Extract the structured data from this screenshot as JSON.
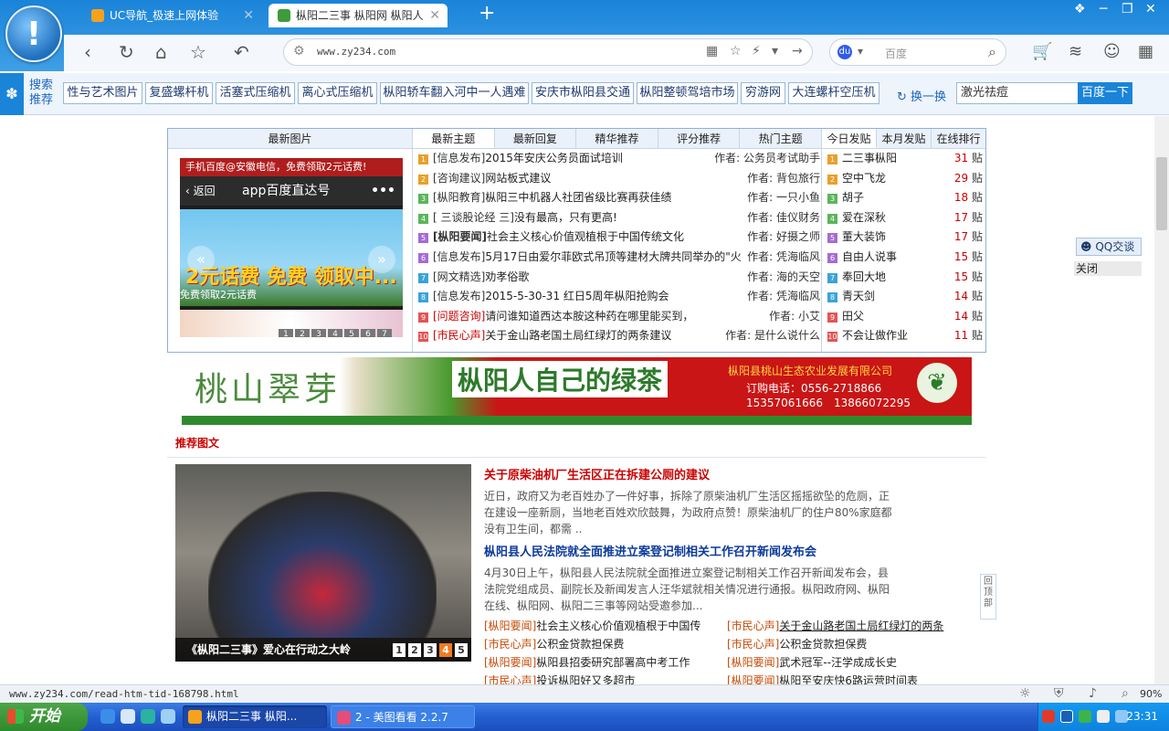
{
  "browser": {
    "tabs": [
      {
        "title": "UC导航_极速上网体验"
      },
      {
        "title": "枞阳二三事 枞阳网 枞阳人"
      }
    ],
    "url": "www.zy234.com",
    "search_placeholder": "百度"
  },
  "rec_bar": {
    "title": "搜索推荐",
    "keywords": [
      "性与艺术图片",
      "复盛螺杆机",
      "活塞式压缩机",
      "离心式压缩机",
      "枞阳轿车翻入河中一人遇难",
      "安庆市枞阳县交通",
      "枞阳整顿驾培市场",
      "穷游网",
      "大连螺杆空压机"
    ],
    "refresh_label": "换一换",
    "input_value": "激光祛痘",
    "search_button": "百度一下"
  },
  "left_panel": {
    "header": "最新图片",
    "ad_top": "手机百度@安徽电信，免费领取2元话费!",
    "ad_back": "返回",
    "ad_title": "app百度直达号",
    "ad_headline": "2元话费 免费 领取中...",
    "ad_sub": "免费领取2元话费",
    "pager": [
      "1",
      "2",
      "3",
      "4",
      "5",
      "6",
      "7"
    ]
  },
  "topics": {
    "tabs": [
      "最新主题",
      "最新回复",
      "精华推荐",
      "评分推荐",
      "热门主题"
    ],
    "rows": [
      {
        "n": "1",
        "cat": "[信息发布]",
        "title": "2015年安庆公务员面试培训",
        "author": "作者: 公务员考试助手",
        "color": "#e8a02a"
      },
      {
        "n": "2",
        "cat": "[咨询建议]",
        "title": "网站板式建议",
        "author": "作者: 背包旅行",
        "color": "#e8a02a"
      },
      {
        "n": "3",
        "cat": "[枞阳教育]",
        "title": "枞阳三中机器人社团省级比赛再获佳绩",
        "author": "作者: 一只小鱼",
        "color": "#5bb55b"
      },
      {
        "n": "4",
        "cat": "[ 三谈股论经 三]",
        "title": "没有最高，只有更高!",
        "author": "作者: 佳仪财务",
        "color": "#5bb55b"
      },
      {
        "n": "5",
        "cat": "[枞阳要闻]",
        "title": "社会主义核心价值观植根于中国传统文化",
        "author": "作者: 好摄之师",
        "color": "#a56bd4"
      },
      {
        "n": "6",
        "cat": "[信息发布]",
        "title": "5月17日由爱尔菲欧式吊顶等建材大牌共同举办的\"火",
        "author": "作者: 凭海临风",
        "color": "#a56bd4"
      },
      {
        "n": "7",
        "cat": "[网文精选]",
        "title": "劝孝俗歌",
        "author": "作者: 海的天空",
        "color": "#3aa3d8"
      },
      {
        "n": "8",
        "cat": "[信息发布]",
        "title": "2015-5-30-31 红日5周年枞阳抢购会",
        "author": "作者: 凭海临风",
        "color": "#3aa3d8"
      },
      {
        "n": "9",
        "cat": "[问题咨询]",
        "title": "请问谁知道西达本胺这种药在哪里能买到，",
        "author": "作者: 小艾",
        "color": "#e25555"
      },
      {
        "n": "10",
        "cat": "[市民心声]",
        "title": "关于金山路老国土局红绿灯的两条建议",
        "author": "作者: 是什么说什么",
        "color": "#e25555"
      }
    ]
  },
  "ranking": {
    "tabs": [
      "今日发贴",
      "本月发贴",
      "在线排行"
    ],
    "unit": "贴",
    "rows": [
      {
        "n": "1",
        "name": "二三事枞阳",
        "count": "31",
        "color": "#e8a02a"
      },
      {
        "n": "2",
        "name": "空中飞龙",
        "count": "29",
        "color": "#e8a02a"
      },
      {
        "n": "3",
        "name": "胡子",
        "count": "18",
        "color": "#5bb55b"
      },
      {
        "n": "4",
        "name": "爱在深秋",
        "count": "17",
        "color": "#5bb55b"
      },
      {
        "n": "5",
        "name": "董大装饰",
        "count": "17",
        "color": "#a56bd4"
      },
      {
        "n": "6",
        "name": "自由人说事",
        "count": "15",
        "color": "#a56bd4"
      },
      {
        "n": "7",
        "name": "奉回大地",
        "count": "15",
        "color": "#3aa3d8"
      },
      {
        "n": "8",
        "name": "青天剑",
        "count": "14",
        "color": "#3aa3d8"
      },
      {
        "n": "9",
        "name": "田父",
        "count": "14",
        "color": "#e25555"
      },
      {
        "n": "10",
        "name": "不会让做作业",
        "count": "11",
        "color": "#e25555"
      }
    ]
  },
  "banner": {
    "left_text": "桃山翠芽",
    "main_text": "枞阳人自己的绿茶",
    "company": "枞阳县桃山生态农业发展有限公司",
    "phone_1": "订购电话：0556-2718866",
    "phone_2": "15357061666　13866072295"
  },
  "recommend": {
    "label": "推荐图文",
    "photo_caption": "《枞阳二三事》爱心在行动之大岭",
    "photo_pager": [
      "1",
      "2",
      "3",
      "4",
      "5"
    ],
    "article_1_title": "关于原柴油机厂生活区正在拆建公厕的建议",
    "article_1_body": "近日，政府又为老百姓办了一件好事，拆除了原柴油机厂生活区摇摇欲坠的危厕，正在建设一座新厕，当地老百姓欢欣鼓舞，为政府点赞！原柴油机厂的住户80%家庭都没有卫生间，都需 ..",
    "article_2_title": "枞阳县人民法院就全面推进立案登记制相关工作召开新闻发布会",
    "article_2_body": "4月30日上午，枞阳县人民法院就全面推进立案登记制相关工作召开新闻发布会，县法院党组成员、副院长及新闻发言人汪华斌就相关情况进行通报。枞阳政府网、枞阳在线、枞阳网、枞阳二三事等网站受邀参加...",
    "news": [
      {
        "cat": "[枞阳要闻]",
        "title": "社会主义核心价值观植根于中国传"
      },
      {
        "cat": "[市民心声]",
        "title": "关于金山路老国土局红绿灯的两条"
      },
      {
        "cat": "[市民心声]",
        "title": "公积金贷款担保费"
      },
      {
        "cat": "[市民心声]",
        "title": "公积金贷款担保费"
      },
      {
        "cat": "[枞阳要闻]",
        "title": "枞阳县招委研究部署高中考工作"
      },
      {
        "cat": "[枞阳要闻]",
        "title": "武术冠军--汪学成成长史"
      },
      {
        "cat": "[市民心声]",
        "title": "投诉枞阳好又多超市"
      },
      {
        "cat": "[枞阳要闻]",
        "title": "枞阳至安庆快6路运营时间表"
      }
    ]
  },
  "widgets": {
    "qq": "QQ交谈",
    "close": "关闭",
    "back_top": "回顶部"
  },
  "status": {
    "url": "www.zy234.com/read-htm-tid-168798.html",
    "zoom": "90%"
  },
  "taskbar": {
    "start": "开始",
    "task_1": "枞阳二三事 枞阳...",
    "task_2": "2 - 美图看看 2.2.7",
    "clock": "23:31"
  }
}
